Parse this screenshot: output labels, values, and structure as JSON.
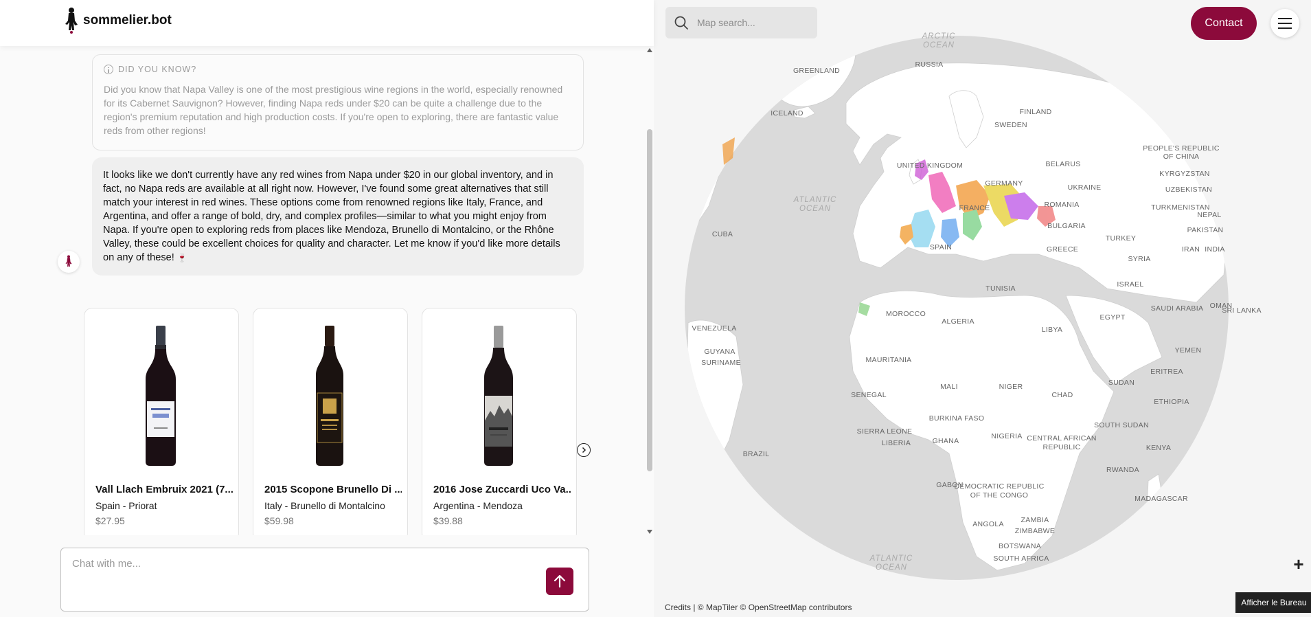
{
  "app": {
    "brand": "sommelier.bot",
    "accent_color": "#8c0a3b"
  },
  "did_you_know": {
    "heading": "DID YOU KNOW?",
    "icon": "info-icon",
    "body": "Did you know that Napa Valley is one of the most prestigious wine regions in the world, especially renowned for its Cabernet Sauvignon? However, finding Napa reds under $20 can be quite a challenge due to the region's premium reputation and high production costs. If you're open to exploring, there are fantastic value reds from other regions!"
  },
  "bot_message": {
    "text": "It looks like we don't currently have any red wines from Napa under $20 in our global inventory, and in fact, no Napa reds are available at all right now. However, I've found some great alternatives that still match your interest in red wines. These options come from renowned regions like Italy, France, and Argentina, and offer a range of bold, dry, and complex profiles—similar to what you might enjoy from Napa. If you're open to exploring reds from places like Mendoza, Brunello di Montalcino, or the Rhône Valley, these could be excellent choices for quality and character. Let me know if you'd like more details on any of these!",
    "emoji": "🍷"
  },
  "wines": [
    {
      "name": "Vall Llach Embruix 2021 (7...",
      "region": "Spain - Priorat",
      "price": "$27.95"
    },
    {
      "name": "2015 Scopone Brunello Di ...",
      "region": "Italy - Brunello di Montalcino",
      "price": "$59.98"
    },
    {
      "name": "2016 Jose Zuccardi Uco Va...",
      "region": "Argentina - Mendoza",
      "price": "$39.88"
    }
  ],
  "chat_input": {
    "placeholder": "Chat with me..."
  },
  "map": {
    "search_placeholder": "Map search...",
    "contact_label": "Contact",
    "zoom_in": "+",
    "attribution": "Credits | © MapTiler © OpenStreetMap contributors",
    "afficher": "Afficher le Bureau",
    "oceans": [
      "ARCTIC",
      "OCEAN",
      "ATLANTIC",
      "OCEAN",
      "ATLANTIC",
      "OCEAN"
    ],
    "countries": [
      "RUSSIA",
      "GREENLAND",
      "FINLAND",
      "ICELAND",
      "SWEDEN",
      "PEOPLE'S REPUBLIC",
      "OF CHINA",
      "UNITED KINGDOM",
      "BELARUS",
      "KYRGYZSTAN",
      "GERMANY",
      "UKRAINE",
      "UZBEKISTAN",
      "FRANCE",
      "ROMANIA",
      "TURKMENISTAN",
      "NEPAL",
      "BULGARIA",
      "PAKISTAN",
      "CUBA",
      "TURKEY",
      "SPAIN",
      "GREECE",
      "IRAN",
      "INDIA",
      "SYRIA",
      "TUNISIA",
      "ISRAEL",
      "MOROCCO",
      "VENEZUELA",
      "ALGERIA",
      "LIBYA",
      "EGYPT",
      "SAUDI ARABIA",
      "OMAN",
      "SRI LANKA",
      "GUYANA",
      "SURINAME",
      "MAURITANIA",
      "YEMEN",
      "ERITREA",
      "MALI",
      "NIGER",
      "SUDAN",
      "SENEGAL",
      "CHAD",
      "ETHIOPIA",
      "BURKINA FASO",
      "SOUTH SUDAN",
      "SIERRA LEONE",
      "NIGERIA",
      "CENTRAL AFRICAN",
      "REPUBLIC",
      "LIBERIA",
      "GHANA",
      "KENYA",
      "BRAZIL",
      "RWANDA",
      "GABON",
      "DEMOCRATIC REPUBLIC",
      "OF THE CONGO",
      "MADAGASCAR",
      "ANGOLA",
      "ZAMBIA",
      "ZIMBABWE",
      "BOTSWANA",
      "SOUTH AFRICA"
    ]
  }
}
